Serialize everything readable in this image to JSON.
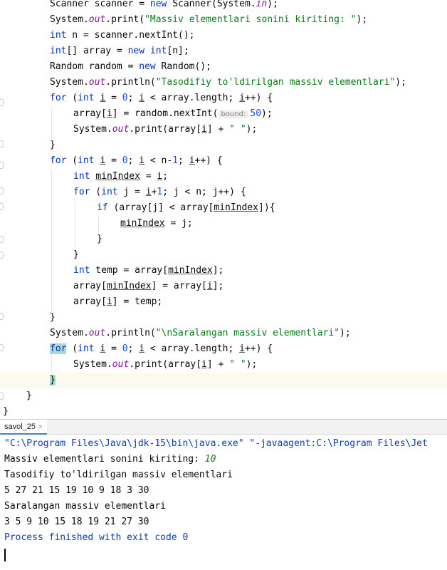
{
  "editor": {
    "code": {
      "l1": {
        "a": "Scanner scanner = ",
        "kw": "new",
        "b": " Scanner(System.",
        "fld": "in",
        "c": ");"
      },
      "l2": {
        "a": "System.",
        "fld": "out",
        "b": ".print(",
        "str": "\"Massiv elementlari sonini kiriting: \"",
        "c": ");"
      },
      "l3": {
        "kw": "int",
        "a": " n = scanner.nextInt();"
      },
      "l4": {
        "kw1": "int",
        "a": "[] array = ",
        "kw2": "new",
        "sp": " ",
        "kw3": "int",
        "b": "[n];"
      },
      "l5": {
        "a": "Random random = ",
        "kw": "new",
        "b": " Random();"
      },
      "l6": {
        "a": "System.",
        "fld": "out",
        "b": ".println(",
        "str": "\"Tasodifiy to'ldirilgan massiv elementlari\"",
        "c": ");"
      },
      "l7": {
        "kw1": "for",
        "a": " (",
        "kw2": "int",
        "sp": " ",
        "i1": "i",
        "b": " = ",
        "num": "0",
        "c": "; ",
        "i2": "i",
        "d": " < array.length; ",
        "i3": "i",
        "e": "++) {"
      },
      "l8": {
        "a": "array[",
        "i": "i",
        "b": "] = random.nextInt(",
        "hint": "bound:",
        "num": "50",
        "c": ");"
      },
      "l9": {
        "a": "System.",
        "fld": "out",
        "b": ".print(array[",
        "i": "i",
        "c": "] + ",
        "str": "\" \"",
        "d": ");"
      },
      "l10": {
        "a": "}"
      },
      "l11": {
        "kw1": "for",
        "a": " (",
        "kw2": "int",
        "sp": " ",
        "i1": "i",
        "b": " = ",
        "num": "0",
        "c": "; ",
        "i2": "i",
        "d": " < n-",
        "num2": "1",
        "e": "; ",
        "i3": "i",
        "f": "++) {"
      },
      "l12": {
        "kw": "int",
        "sp": " ",
        "u1": "minIndex",
        "a": " = ",
        "u2": "i",
        "b": ";"
      },
      "l13": {
        "kw1": "for",
        "a": " (",
        "kw2": "int",
        "b": " j = ",
        "i": "i",
        "c": "+",
        "num": "1",
        "d": "; j < n; j++) {"
      },
      "l14": {
        "kw": "if",
        "a": " (array[j] < array[",
        "u": "minIndex",
        "b": "]){"
      },
      "l15": {
        "u": "minIndex",
        "a": " = j;"
      },
      "l16": {
        "a": "}"
      },
      "l17": {
        "a": "}"
      },
      "l18": {
        "kw": "int",
        "a": " temp = array[",
        "u": "minIndex",
        "b": "];"
      },
      "l19": {
        "a": "array[",
        "u": "minIndex",
        "b": "] = array[",
        "i": "i",
        "c": "];"
      },
      "l20": {
        "a": "array[",
        "i": "i",
        "b": "] = temp;"
      },
      "l21": {
        "a": "}"
      },
      "l22": {
        "a": "System.",
        "fld": "out",
        "b": ".println(",
        "str": "\"\\nSaralangan massiv elementlari\"",
        "c": ");"
      },
      "l23": {
        "kw1": "for",
        "a": " (",
        "kw2": "int",
        "sp": " ",
        "i1": "i",
        "b": " = ",
        "num": "0",
        "c": "; ",
        "i2": "i",
        "d": " < array.length; ",
        "i3": "i",
        "e": "++) {"
      },
      "l24": {
        "a": "System.",
        "fld": "out",
        "b": ".print(array[",
        "i": "i",
        "c": "] + ",
        "str": "\" \"",
        "d": ");"
      },
      "l25": {
        "a": "}"
      },
      "l26": {
        "a": "}"
      },
      "l27": {
        "a": "}"
      }
    }
  },
  "console": {
    "tab_label": "savol_25",
    "tab_close": "×",
    "lines": {
      "cmd": "\"C:\\Program Files\\Java\\jdk-15\\bin\\java.exe\" \"-javaagent:C:\\Program Files\\Jet",
      "prompt": "Massiv elementlari sonini kiriting: ",
      "user_input": "10",
      "heading1": "Tasodifiy to'ldirilgan massiv elementlari",
      "random_values": "5 27 21 15 19 10 9 18 3 30",
      "heading2": "Saralangan massiv elementlari",
      "sorted_values": "3 5 9 10 15 18 19 21 27 30",
      "finished": "Process finished with exit code 0"
    }
  },
  "colors": {
    "keyword": "#0033b3",
    "string": "#067d17",
    "number": "#1750eb",
    "field": "#871094",
    "current_line": "#fcfaed"
  }
}
